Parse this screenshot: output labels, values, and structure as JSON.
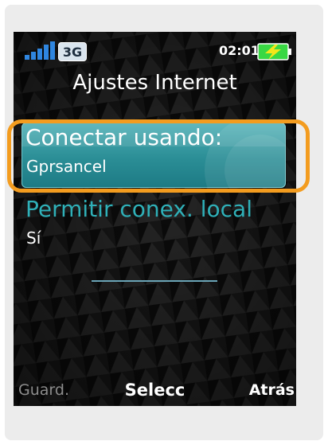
{
  "status_bar": {
    "network": "3G",
    "time": "02:01",
    "signal_icon": "signal-bars-icon",
    "battery_icon": "battery-charging-icon",
    "battery_color": "#39d843",
    "bolt_color": "#f4e61a"
  },
  "screen": {
    "title": "Ajustes Internet"
  },
  "settings": [
    {
      "label": "Conectar usando:",
      "value": "Gprsancel",
      "selected": true
    },
    {
      "label": "Permitir conex. local",
      "value": "Sí",
      "selected": false
    }
  ],
  "softkeys": {
    "left": "Guard.",
    "center": "Selecc",
    "right": "Atrás"
  },
  "colors": {
    "highlight_ring": "#f39c1f",
    "selection": "#2b8e96",
    "label_accent": "#2fb0b8"
  }
}
